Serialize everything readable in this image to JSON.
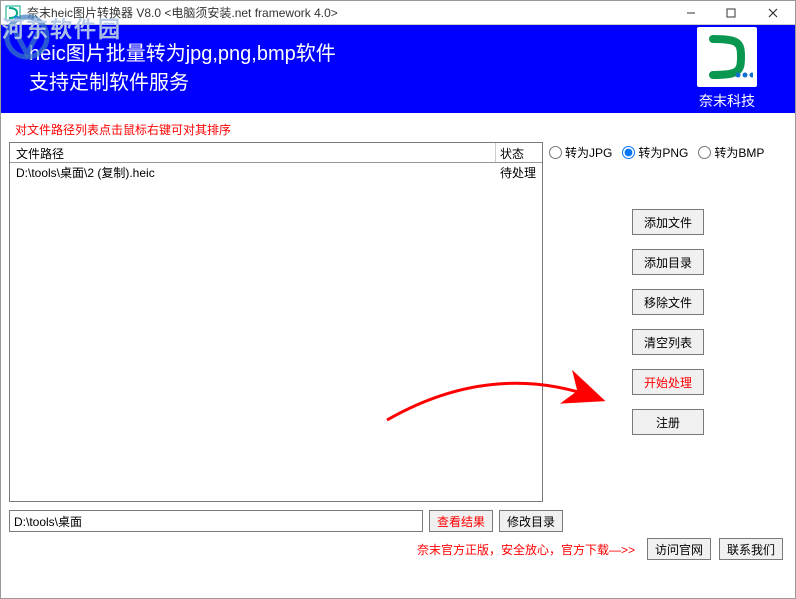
{
  "window": {
    "title": "奈末heic图片转换器 V8.0 <电脑须安装.net framework 4.0>"
  },
  "banner": {
    "line1": "heic图片批量转为jpg,png,bmp软件",
    "line2": "支持定制软件服务",
    "brand": "奈末科技"
  },
  "watermark": "河东软件园",
  "hint": "对文件路径列表点击鼠标右键可对其排序",
  "list": {
    "header_path": "文件路径",
    "header_status": "状态",
    "rows": [
      {
        "path": "D:\\tools\\桌面\\2 (复制).heic",
        "status": "待处理"
      }
    ]
  },
  "formats": {
    "jpg": "转为JPG",
    "png": "转为PNG",
    "bmp": "转为BMP",
    "selected": "png"
  },
  "buttons": {
    "add_file": "添加文件",
    "add_dir": "添加目录",
    "remove": "移除文件",
    "clear": "清空列表",
    "start": "开始处理",
    "register": "注册",
    "view_result": "查看结果",
    "change_dir": "修改目录",
    "visit_site": "访问官网",
    "contact": "联系我们"
  },
  "output_path": "D:\\tools\\桌面",
  "footer_text": "奈末官方正版，安全放心，官方下载—>>"
}
